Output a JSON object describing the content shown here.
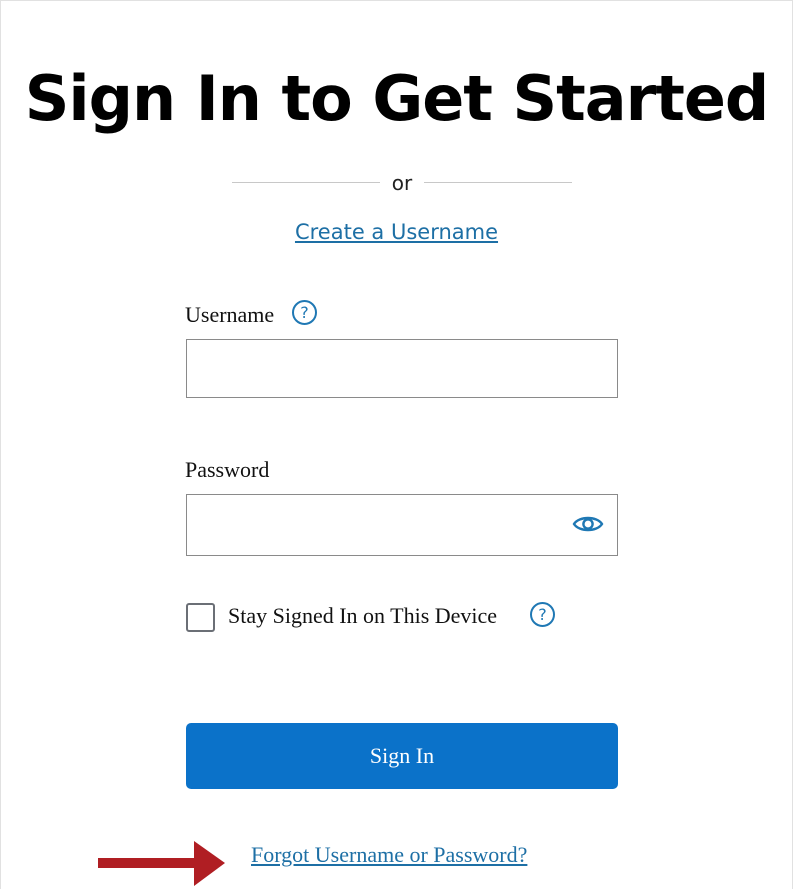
{
  "header": {
    "title": "Sign In to Get Started"
  },
  "divider": {
    "text": "or"
  },
  "links": {
    "create_username": "Create a Username",
    "forgot": "Forgot Username or Password?"
  },
  "form": {
    "username": {
      "label": "Username",
      "value": "",
      "help_icon": "question-circle-icon"
    },
    "password": {
      "label": "Password",
      "value": "",
      "toggle_icon": "eye-icon"
    },
    "stay_signed_in": {
      "label": "Stay Signed In on This Device",
      "checked": false,
      "help_icon": "question-circle-icon"
    },
    "submit_label": "Sign In"
  },
  "icons": {
    "help_glyph": "?"
  },
  "colors": {
    "primary_button": "#0b72c9",
    "link": "#1d6fa5",
    "help_icon": "#1f78b4",
    "annotation_arrow": "#b01e23"
  }
}
